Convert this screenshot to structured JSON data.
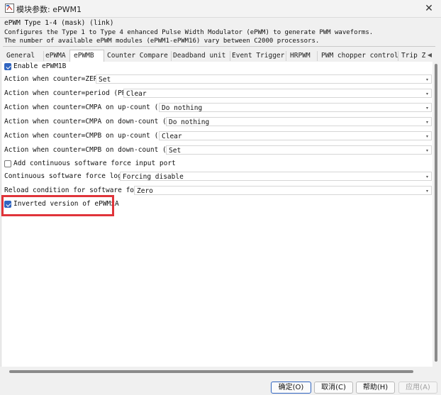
{
  "window": {
    "title": "模块参数: ePWM1",
    "close_glyph": "✕"
  },
  "description": {
    "header": "ePWM Type 1-4 (mask) (link)",
    "lines": [
      "Configures the Type 1 to Type 4 enhanced Pulse Width Modulator (ePWM) to generate PWM waveforms.",
      "The number of available ePWM modules (ePWM1-ePWM16) vary between C2000 processors."
    ]
  },
  "tabs": [
    {
      "label": "General"
    },
    {
      "label": "ePWMA"
    },
    {
      "label": "ePWMB",
      "active": true
    },
    {
      "label": "Counter Compare"
    },
    {
      "label": "Deadband unit"
    },
    {
      "label": "Event Trigger"
    },
    {
      "label": "HRPWM"
    },
    {
      "label": "PWM chopper control"
    },
    {
      "label": "Trip Z"
    }
  ],
  "tab_scroll_glyph": "◀",
  "params": {
    "enable_epwm1b": {
      "label": "Enable ePWM1B",
      "checked": true
    },
    "zero": {
      "label": "Action when counter=ZERO:",
      "value": "Set"
    },
    "period": {
      "label": "Action when counter=period (PRD):",
      "value": "Clear"
    },
    "cau": {
      "label": "Action when counter=CMPA on up-count (CAU):",
      "value": "Do nothing"
    },
    "cad": {
      "label": "Action when counter=CMPA on down-count (CAD):",
      "value": "Do nothing"
    },
    "cbu": {
      "label": "Action when counter=CMPB on up-count (CBU):",
      "value": "Clear"
    },
    "cbd": {
      "label": "Action when counter=CMPB on down-count (CBD):",
      "value": "Set"
    },
    "add_sw_force": {
      "label": "Add continuous software force input port",
      "checked": false
    },
    "sw_force_logic": {
      "label": "Continuous software force logic:",
      "value": "Forcing disable"
    },
    "reload_condition": {
      "label": "Reload condition for software force:",
      "value": "Zero"
    },
    "inverted": {
      "label": "Inverted version of ePWMxA",
      "checked": true
    }
  },
  "dropdown_arrow": "▾",
  "buttons": {
    "ok": "确定(O)",
    "cancel": "取消(C)",
    "help": "帮助(H)",
    "apply": "应用(A)"
  },
  "colors": {
    "highlight_box": "#e0343a",
    "checkbox_accent": "#2f64c0"
  }
}
